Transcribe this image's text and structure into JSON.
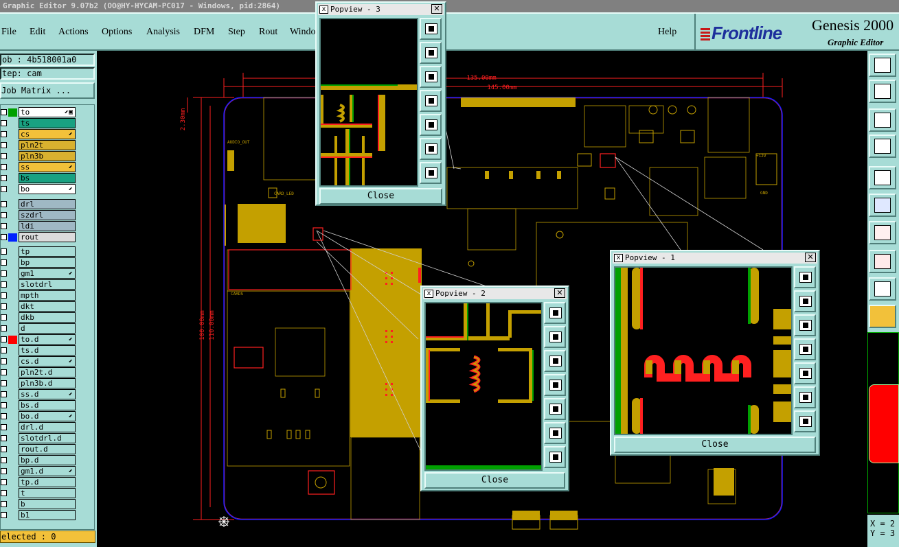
{
  "window": {
    "title": "Graphic Editor 9.07b2 (OO@HY-HYCAM-PC017 - Windows, pid:2864)"
  },
  "menu": {
    "items": [
      "File",
      "Edit",
      "Actions",
      "Options",
      "Analysis",
      "DFM",
      "Step",
      "Rout",
      "Windo"
    ],
    "help": "Help"
  },
  "brand": {
    "logo": "Frontline",
    "product": "Genesis 2000",
    "subtitle": "Graphic Editor"
  },
  "left_panel": {
    "job": "ob : 4b518001a0",
    "step": "tep: cam",
    "job_matrix": "Job Matrix ...",
    "selected": "elected : 0"
  },
  "layers": [
    {
      "name": "to",
      "fill": "#ffffff",
      "color": "#00a000",
      "mark": "⬋▣"
    },
    {
      "name": "ts",
      "fill": "#19a181",
      "color": "",
      "mark": ""
    },
    {
      "name": "cs",
      "fill": "#f2c13a",
      "color": "",
      "mark": "⬋"
    },
    {
      "name": "pln2t",
      "fill": "#d9b12f",
      "color": "",
      "mark": ""
    },
    {
      "name": "pln3b",
      "fill": "#d9b12f",
      "color": "",
      "mark": ""
    },
    {
      "name": "ss",
      "fill": "#f2c13a",
      "color": "",
      "mark": "⬋"
    },
    {
      "name": "bs",
      "fill": "#19a181",
      "color": "",
      "mark": ""
    },
    {
      "name": "bo",
      "fill": "#ffffff",
      "color": "",
      "mark": "⬋"
    },
    {
      "name": "drl",
      "fill": "#9fb8c4",
      "color": "",
      "mark": ""
    },
    {
      "name": "szdrl",
      "fill": "#9fb8c4",
      "color": "",
      "mark": ""
    },
    {
      "name": "ldi",
      "fill": "#9fb8c4",
      "color": "",
      "mark": ""
    },
    {
      "name": "rout",
      "fill": "#dcdcdc",
      "color": "#0022ff",
      "mark": ""
    },
    {
      "name": "tp",
      "fill": "#a7dcd6",
      "color": "",
      "mark": ""
    },
    {
      "name": "bp",
      "fill": "#a7dcd6",
      "color": "",
      "mark": ""
    },
    {
      "name": "gm1",
      "fill": "#a7dcd6",
      "color": "",
      "mark": "⬋"
    },
    {
      "name": "slotdrl",
      "fill": "#a7dcd6",
      "color": "",
      "mark": ""
    },
    {
      "name": "mpth",
      "fill": "#a7dcd6",
      "color": "",
      "mark": ""
    },
    {
      "name": "dkt",
      "fill": "#a7dcd6",
      "color": "",
      "mark": ""
    },
    {
      "name": "dkb",
      "fill": "#a7dcd6",
      "color": "",
      "mark": ""
    },
    {
      "name": "d",
      "fill": "#a7dcd6",
      "color": "",
      "mark": ""
    },
    {
      "name": "to.d",
      "fill": "#a7dcd6",
      "color": "#ff0000",
      "mark": "⬋"
    },
    {
      "name": "ts.d",
      "fill": "#a7dcd6",
      "color": "",
      "mark": ""
    },
    {
      "name": "cs.d",
      "fill": "#a7dcd6",
      "color": "",
      "mark": "⬋"
    },
    {
      "name": "pln2t.d",
      "fill": "#a7dcd6",
      "color": "",
      "mark": ""
    },
    {
      "name": "pln3b.d",
      "fill": "#a7dcd6",
      "color": "",
      "mark": ""
    },
    {
      "name": "ss.d",
      "fill": "#a7dcd6",
      "color": "",
      "mark": "⬋"
    },
    {
      "name": "bs.d",
      "fill": "#a7dcd6",
      "color": "",
      "mark": ""
    },
    {
      "name": "bo.d",
      "fill": "#a7dcd6",
      "color": "",
      "mark": "⬋"
    },
    {
      "name": "drl.d",
      "fill": "#a7dcd6",
      "color": "",
      "mark": ""
    },
    {
      "name": "slotdrl.d",
      "fill": "#a7dcd6",
      "color": "",
      "mark": ""
    },
    {
      "name": "rout.d",
      "fill": "#a7dcd6",
      "color": "",
      "mark": ""
    },
    {
      "name": "bp.d",
      "fill": "#a7dcd6",
      "color": "",
      "mark": ""
    },
    {
      "name": "gm1.d",
      "fill": "#a7dcd6",
      "color": "",
      "mark": "⬋"
    },
    {
      "name": "tp.d",
      "fill": "#a7dcd6",
      "color": "",
      "mark": ""
    },
    {
      "name": "t",
      "fill": "#a7dcd6",
      "color": "",
      "mark": ""
    },
    {
      "name": "b",
      "fill": "#a7dcd6",
      "color": "",
      "mark": ""
    },
    {
      "name": "b1",
      "fill": "#a7dcd6",
      "color": "",
      "mark": ""
    }
  ],
  "dimensions": {
    "width_inner": "135.00mm",
    "width_outer": "145.00mm",
    "height_inner": "100.00mm",
    "height_outer": "110.00mm",
    "offset": "2.30mm"
  },
  "board_labels": {
    "audio_out": "AUDIO_OUT",
    "card_led": "CARD_LED",
    "plus12v": "+12V",
    "gnd": "GND",
    "cards": "CARDS"
  },
  "popviews": [
    {
      "title": "Popview - 3",
      "close_label": "Close"
    },
    {
      "title": "Popview - 2",
      "close_label": "Close"
    },
    {
      "title": "Popview - 1",
      "close_label": "Close"
    }
  ],
  "coords": {
    "x_label": "X = 2",
    "y_label": "Y = 3"
  },
  "colors": {
    "panel": "#a7dcd6",
    "copper": "#c4a000",
    "outline": "#1a1aff",
    "dimension": "#ff2020"
  }
}
